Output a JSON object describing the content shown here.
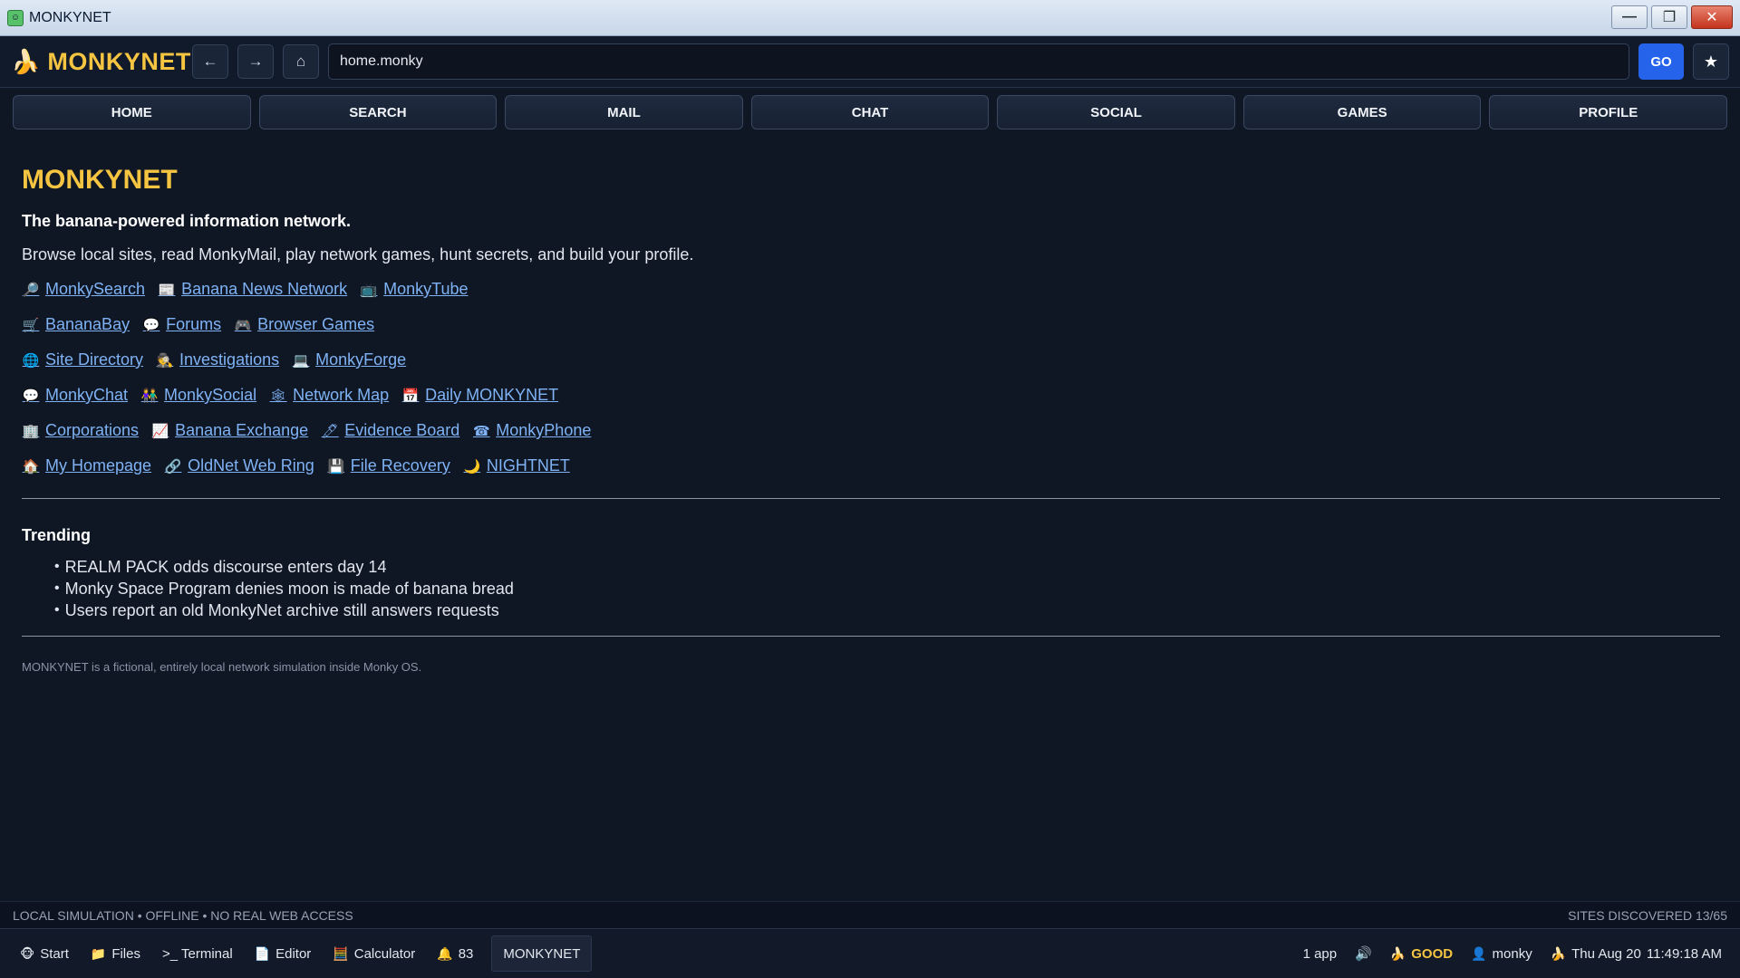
{
  "window": {
    "title": "MONKYNET",
    "minimize_glyph": "—",
    "restore_glyph": "❐",
    "close_glyph": "✕"
  },
  "toolbar": {
    "logo_text": "MONKYNET",
    "back_glyph": "←",
    "forward_glyph": "→",
    "home_glyph": "⌂",
    "url_value": "home.monky",
    "go_label": "GO",
    "bookmark_glyph": "★"
  },
  "nav": {
    "tabs": [
      "HOME",
      "SEARCH",
      "MAIL",
      "CHAT",
      "SOCIAL",
      "GAMES",
      "PROFILE"
    ]
  },
  "main": {
    "title": "MONKYNET",
    "tagline": "The banana-powered information network.",
    "description": "Browse local sites, read MonkyMail, play network games, hunt secrets, and build your profile.",
    "link_rows": [
      [
        {
          "icon": "🔎",
          "icon_name": "magnifier-icon",
          "label": "MonkySearch"
        },
        {
          "icon": "📰",
          "icon_name": "newspaper-icon",
          "label": "Banana News Network"
        },
        {
          "icon": "📺",
          "icon_name": "television-icon",
          "label": "MonkyTube"
        }
      ],
      [
        {
          "icon": "🛒",
          "icon_name": "cart-icon",
          "label": "BananaBay"
        },
        {
          "icon": "💬",
          "icon_name": "speech-bubble-icon",
          "label": "Forums"
        },
        {
          "icon": "🎮",
          "icon_name": "gamepad-icon",
          "label": "Browser Games"
        }
      ],
      [
        {
          "icon": "🌐",
          "icon_name": "globe-icon",
          "label": "Site Directory"
        },
        {
          "icon": "🕵",
          "icon_name": "detective-icon",
          "label": "Investigations"
        },
        {
          "icon": "💻",
          "icon_name": "laptop-icon",
          "label": "MonkyForge"
        }
      ],
      [
        {
          "icon": "💬",
          "icon_name": "chat-icon",
          "label": "MonkyChat"
        },
        {
          "icon": "👫",
          "icon_name": "people-icon",
          "label": "MonkySocial"
        },
        {
          "icon": "🕸",
          "icon_name": "network-icon",
          "label": "Network Map"
        },
        {
          "icon": "📅",
          "icon_name": "calendar-icon",
          "label": "Daily MONKYNET"
        }
      ],
      [
        {
          "icon": "🏢",
          "icon_name": "building-icon",
          "label": "Corporations"
        },
        {
          "icon": "📈",
          "icon_name": "chart-up-icon",
          "label": "Banana Exchange"
        },
        {
          "icon": "🖊",
          "icon_name": "pin-icon",
          "label": "Evidence Board"
        },
        {
          "icon": "☎",
          "icon_name": "phone-icon",
          "label": "MonkyPhone"
        }
      ],
      [
        {
          "icon": "🏠",
          "icon_name": "house-icon",
          "label": "My Homepage"
        },
        {
          "icon": "🔗",
          "icon_name": "link-icon",
          "label": "OldNet Web Ring"
        },
        {
          "icon": "💾",
          "icon_name": "floppy-icon",
          "label": "File Recovery"
        },
        {
          "icon": "🌙",
          "icon_name": "moon-icon",
          "label": "NIGHTNET"
        }
      ]
    ],
    "trending_title": "Trending",
    "trending": [
      "REALM PACK odds discourse enters day 14",
      "Monky Space Program denies moon is made of banana bread",
      "Users report an old MonkyNet archive still answers requests"
    ],
    "disclaimer": "MONKYNET is a fictional, entirely local network simulation inside Monky OS."
  },
  "status": {
    "left": "LOCAL SIMULATION • OFFLINE • NO REAL WEB ACCESS",
    "right": "SITES DISCOVERED 13/65"
  },
  "taskbar": {
    "start": "Start",
    "files": "Files",
    "terminal": ">_ Terminal",
    "editor": "Editor",
    "calculator": "Calculator",
    "notifications": "83",
    "open_window": "MONKYNET",
    "app_count": "1 app",
    "mood": "GOOD",
    "user": "monky",
    "date": "Thu Aug 20",
    "time": "11:49:18 AM"
  },
  "colors": {
    "accent": "#f5c542",
    "link": "#7fb3f5",
    "go_button": "#2563eb",
    "background": "#0f1624"
  }
}
